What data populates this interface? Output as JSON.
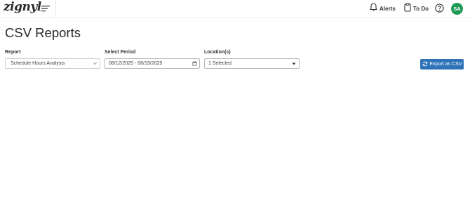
{
  "header": {
    "logo_text": "zignyl",
    "nav": {
      "alerts_label": "Alerts",
      "todo_label": "To Do"
    },
    "avatar_initials": "SA",
    "avatar_color": "#1f9b56"
  },
  "page": {
    "title": "CSV Reports"
  },
  "filters": {
    "report": {
      "label": "Report",
      "value": "Schedule Hours Analysis"
    },
    "period": {
      "label": "Select Period",
      "value": "08/12/2025 - 08/19/2025"
    },
    "locations": {
      "label": "Location(s)",
      "value": "1 Selected"
    }
  },
  "actions": {
    "export_label": "Export as CSV",
    "export_color": "#2e73b8"
  },
  "icons": {
    "menu": "hamburger-menu-icon",
    "alerts": "bell-icon",
    "todo": "clipboard-icon",
    "help": "question-circle-icon",
    "report_dropdown": "chevron-down-icon",
    "period": "calendar-icon",
    "locations_dropdown": "caret-down-icon",
    "export": "refresh-icon"
  }
}
